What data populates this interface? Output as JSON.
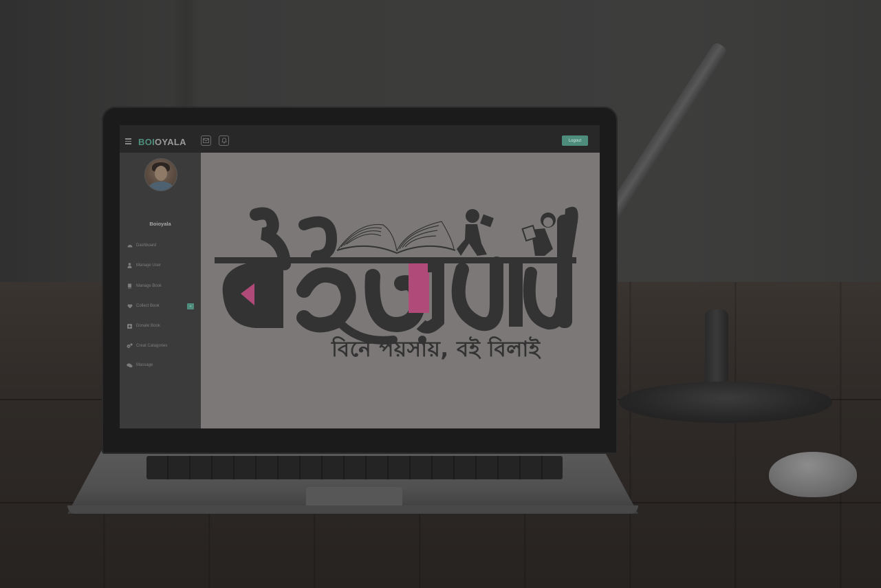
{
  "app": {
    "brand_primary": "BOI",
    "brand_secondary": "OYALA",
    "logout_label": "Logout",
    "user_name": "Boioyala"
  },
  "sidebar": {
    "items": [
      {
        "label": "Dashboard",
        "icon": "dashboard-icon"
      },
      {
        "label": "Manage User",
        "icon": "user-icon"
      },
      {
        "label": "Manage Book",
        "icon": "book-icon"
      },
      {
        "label": "Collect Book",
        "icon": "heart-icon"
      },
      {
        "label": "Donate Book",
        "icon": "plus-square-icon"
      },
      {
        "label": "Creat Catagories",
        "icon": "gears-icon"
      },
      {
        "label": "Massage",
        "icon": "comments-icon"
      }
    ]
  },
  "logo": {
    "text_bengali": "বইওয়ালী",
    "tagline": "বিনে পয়সায়, বই বিলাই"
  },
  "colors": {
    "accent": "#4e8c7c",
    "logo_dark": "#333333",
    "logo_pink": "#b04a78",
    "content_bg": "#7b7877"
  }
}
